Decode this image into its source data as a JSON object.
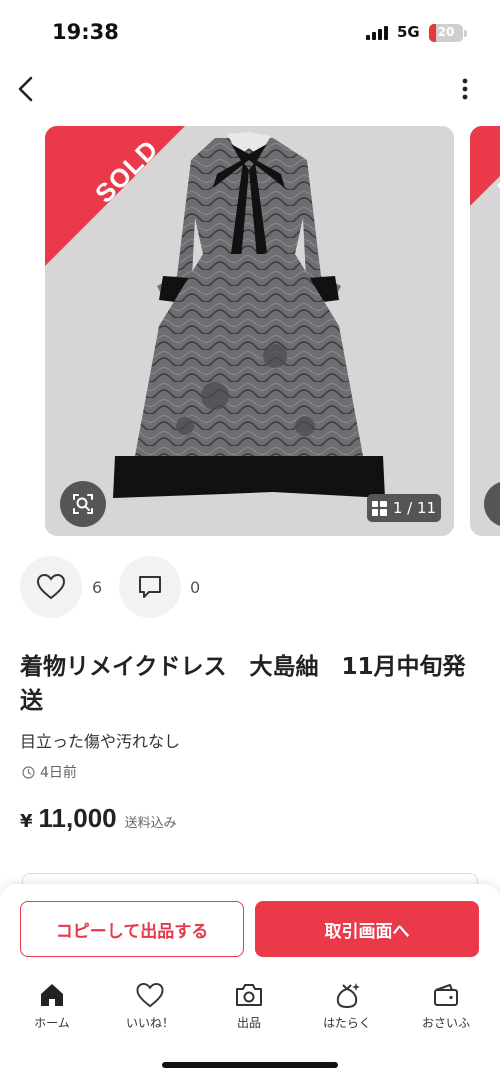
{
  "status_bar": {
    "time": "19:38",
    "network": "5G",
    "battery": "20",
    "battery_level": 0.2,
    "battery_color": "#e53935"
  },
  "nav": {
    "back_icon": "chevron-left-icon",
    "more_icon": "more-vertical-icon"
  },
  "gallery": {
    "sold_label": "SOLD",
    "sold_color": "#ea3a4a",
    "counter": "1 / 11",
    "zoom_icon": "scan-search-icon",
    "counter_icon": "grid-icon"
  },
  "actions": {
    "like_icon": "heart-icon",
    "like_count": "6",
    "comment_icon": "comment-icon",
    "comment_count": "0"
  },
  "item": {
    "title": "着物リメイクドレス　大島紬　11月中旬発送",
    "condition": "目立った傷や汚れなし",
    "posted": "4日前",
    "currency": "¥",
    "price": "11,000",
    "shipping": "送料込み"
  },
  "cta": {
    "copy_label": "コピーして出品する",
    "trade_label": "取引画面へ",
    "accent_color": "#ea3a4a"
  },
  "tab_bar": {
    "items": [
      {
        "label": "ホーム",
        "icon": "home-icon"
      },
      {
        "label": "いいね！",
        "icon": "heart-icon"
      },
      {
        "label": "出品",
        "icon": "camera-icon"
      },
      {
        "label": "はたらく",
        "icon": "money-bag-icon"
      },
      {
        "label": "おさいふ",
        "icon": "wallet-icon"
      }
    ]
  }
}
